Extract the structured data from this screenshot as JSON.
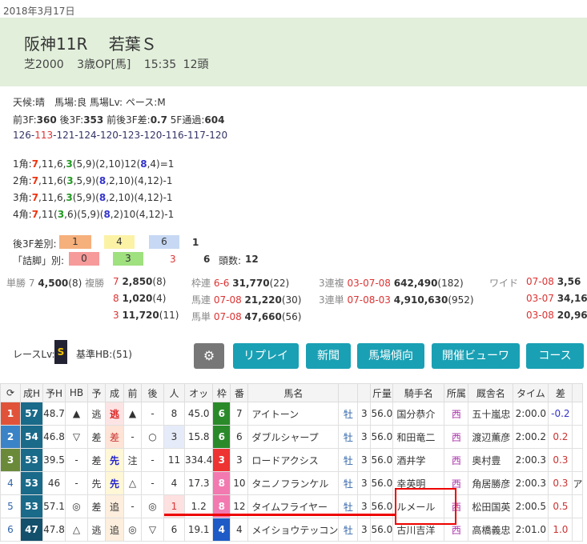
{
  "date": "2018年3月17日",
  "race": {
    "venue": "阪神11R",
    "name": "若葉Ｓ",
    "distance": "芝2000",
    "class": "3歳OP[馬]",
    "time": "15:35",
    "heads": "12頭"
  },
  "cond": {
    "line1": "天候:晴　馬場:良 馬場Lv: ペース:M"
  },
  "pace": {
    "f3_label": "前3F:",
    "f3": "360",
    "m3_label": "後3F:",
    "m3": "353",
    "diff_label": "前後3F差:",
    "diff": "0.7",
    "g5_label": "5F通過:",
    "g5": "604"
  },
  "laps": [
    "126",
    "113",
    "121",
    "124",
    "120",
    "123",
    "120",
    "116",
    "117",
    "120"
  ],
  "corners": [
    {
      "label": "1角:",
      "parts": [
        [
          "r",
          "7"
        ],
        [
          "n",
          ",11,6,"
        ],
        [
          "g",
          "3"
        ],
        [
          "n",
          "(5,9)(2,10)12("
        ],
        [
          "b",
          "8"
        ],
        [
          "n",
          ",4)=1"
        ]
      ]
    },
    {
      "label": "2角:",
      "parts": [
        [
          "r",
          "7"
        ],
        [
          "n",
          ",11,6("
        ],
        [
          "g",
          "3"
        ],
        [
          "n",
          ",5,9)("
        ],
        [
          "b",
          "8"
        ],
        [
          "n",
          ",2,10)(4,12)-1"
        ]
      ]
    },
    {
      "label": "3角:",
      "parts": [
        [
          "r",
          "7"
        ],
        [
          "n",
          ",11,6,"
        ],
        [
          "g",
          "3"
        ],
        [
          "n",
          "(5,9)("
        ],
        [
          "b",
          "8"
        ],
        [
          "n",
          ",2,10)(4,12)-1"
        ]
      ]
    },
    {
      "label": "4角:",
      "parts": [
        [
          "r",
          "7"
        ],
        [
          "n",
          ",11("
        ],
        [
          "g",
          "3"
        ],
        [
          "n",
          ",6)(5,9)("
        ],
        [
          "b",
          "8"
        ],
        [
          "n",
          ",2)10(4,12)-1"
        ]
      ]
    }
  ],
  "late3f": {
    "label": "後3F差別:",
    "v1": "1",
    "v2": "4",
    "v3": "6",
    "v4": "1"
  },
  "tsume": {
    "label": "「詰脚」別:",
    "v1": "0",
    "v2": "3",
    "v3": "3",
    "v4": "6",
    "count_label": "頭数:",
    "count": "12"
  },
  "payout": {
    "tansho": "単勝",
    "tansho_n": "7",
    "tansho_v": "4,500",
    "tansho_p": "(8)",
    "fukusho": "複勝",
    "fuku": [
      [
        "7",
        "2,850",
        "(8)"
      ],
      [
        "8",
        "1,020",
        "(4)"
      ],
      [
        "3",
        "11,720",
        "(11)"
      ]
    ],
    "wakuren": "枠連",
    "wakuren_n": "6-6",
    "wakuren_v": "31,770",
    "wakuren_p": "(22)",
    "umaren": "馬連",
    "umaren_n": "07-08",
    "umaren_v": "21,220",
    "umaren_p": "(30)",
    "umatan": "馬単",
    "umatan_n": "07-08",
    "umatan_v": "47,660",
    "umatan_p": "(56)",
    "sanrenpuku": "3連複",
    "sanrenpuku_n": "03-07-08",
    "sanrenpuku_v": "642,490",
    "sanrenpuku_p": "(182)",
    "sanrentan": "3連単",
    "sanrentan_n": "07-08-03",
    "sanrentan_v": "4,910,630",
    "sanrentan_p": "(952)",
    "wide": "ワイド",
    "wide_rows": [
      [
        "07-08",
        "3,56"
      ],
      [
        "03-07",
        "34,16"
      ],
      [
        "03-08",
        "20,96"
      ]
    ]
  },
  "level": {
    "label": "レースLv:",
    "badge": "S",
    "base": "基準HB:(51)"
  },
  "buttons": {
    "gear": "⚙",
    "replay": "リプレイ",
    "news": "新聞",
    "track": "馬場傾向",
    "viewer": "開催ビューワ",
    "course": "コース"
  },
  "table": {
    "headers": [
      "C",
      "成H",
      "予H",
      "HB",
      "予",
      "成",
      "前",
      "後",
      "人",
      "オッ",
      "枠",
      "番",
      "馬名",
      "",
      "",
      "斤量",
      "騎手名",
      "所属",
      "厩舎名",
      "タイム",
      "差",
      ""
    ],
    "rows": [
      [
        "1",
        "57",
        "48.7",
        "▲",
        "逃",
        "逃",
        "▲",
        "-",
        "8",
        "45.0",
        "6",
        "7",
        "アイトーン",
        "牡",
        "3",
        "56.0",
        "国分恭介",
        "西",
        "五十嵐忠",
        "2:00.0",
        "-0.2",
        ""
      ],
      [
        "2",
        "54",
        "46.8",
        "▽",
        "差",
        "差",
        "-",
        "○",
        "3",
        "15.8",
        "6",
        "6",
        "ダブルシャープ",
        "牡",
        "3",
        "56.0",
        "和田竜二",
        "西",
        "渡辺薫彦",
        "2:00.2",
        "0.2",
        ""
      ],
      [
        "3",
        "53",
        "39.5",
        "-",
        "差",
        "先",
        "注",
        "-",
        "11",
        "334.4",
        "3",
        "3",
        "ロードアクシス",
        "牡",
        "3",
        "56.0",
        "酒井学",
        "西",
        "奥村豊",
        "2:00.3",
        "0.3",
        ""
      ],
      [
        "4",
        "53",
        "46",
        "-",
        "先",
        "先",
        "△",
        "-",
        "4",
        "17.3",
        "8",
        "10",
        "タニノフランケル",
        "牡",
        "3",
        "56.0",
        "幸英明",
        "西",
        "角居勝彦",
        "2:00.3",
        "0.3",
        "ア"
      ],
      [
        "5",
        "53",
        "57.1",
        "◎",
        "差",
        "追",
        "-",
        "◎",
        "1",
        "1.2",
        "8",
        "12",
        "タイムフライヤー",
        "牡",
        "3",
        "56.0",
        "ルメール",
        "西",
        "松田国英",
        "2:00.5",
        "0.5",
        ""
      ],
      [
        "6",
        "47",
        "47.8",
        "△",
        "逃",
        "追",
        "◎",
        "▽",
        "6",
        "19.1",
        "4",
        "4",
        "メイショウテッコン",
        "牡",
        "3",
        "56.0",
        "古川吉洋",
        "西",
        "高橋義忠",
        "2:01.0",
        "1.0",
        ""
      ]
    ]
  },
  "colors": {
    "header_bg": "#e2efdb",
    "accent": "#1aa0b4",
    "highlight": "#e00000"
  }
}
